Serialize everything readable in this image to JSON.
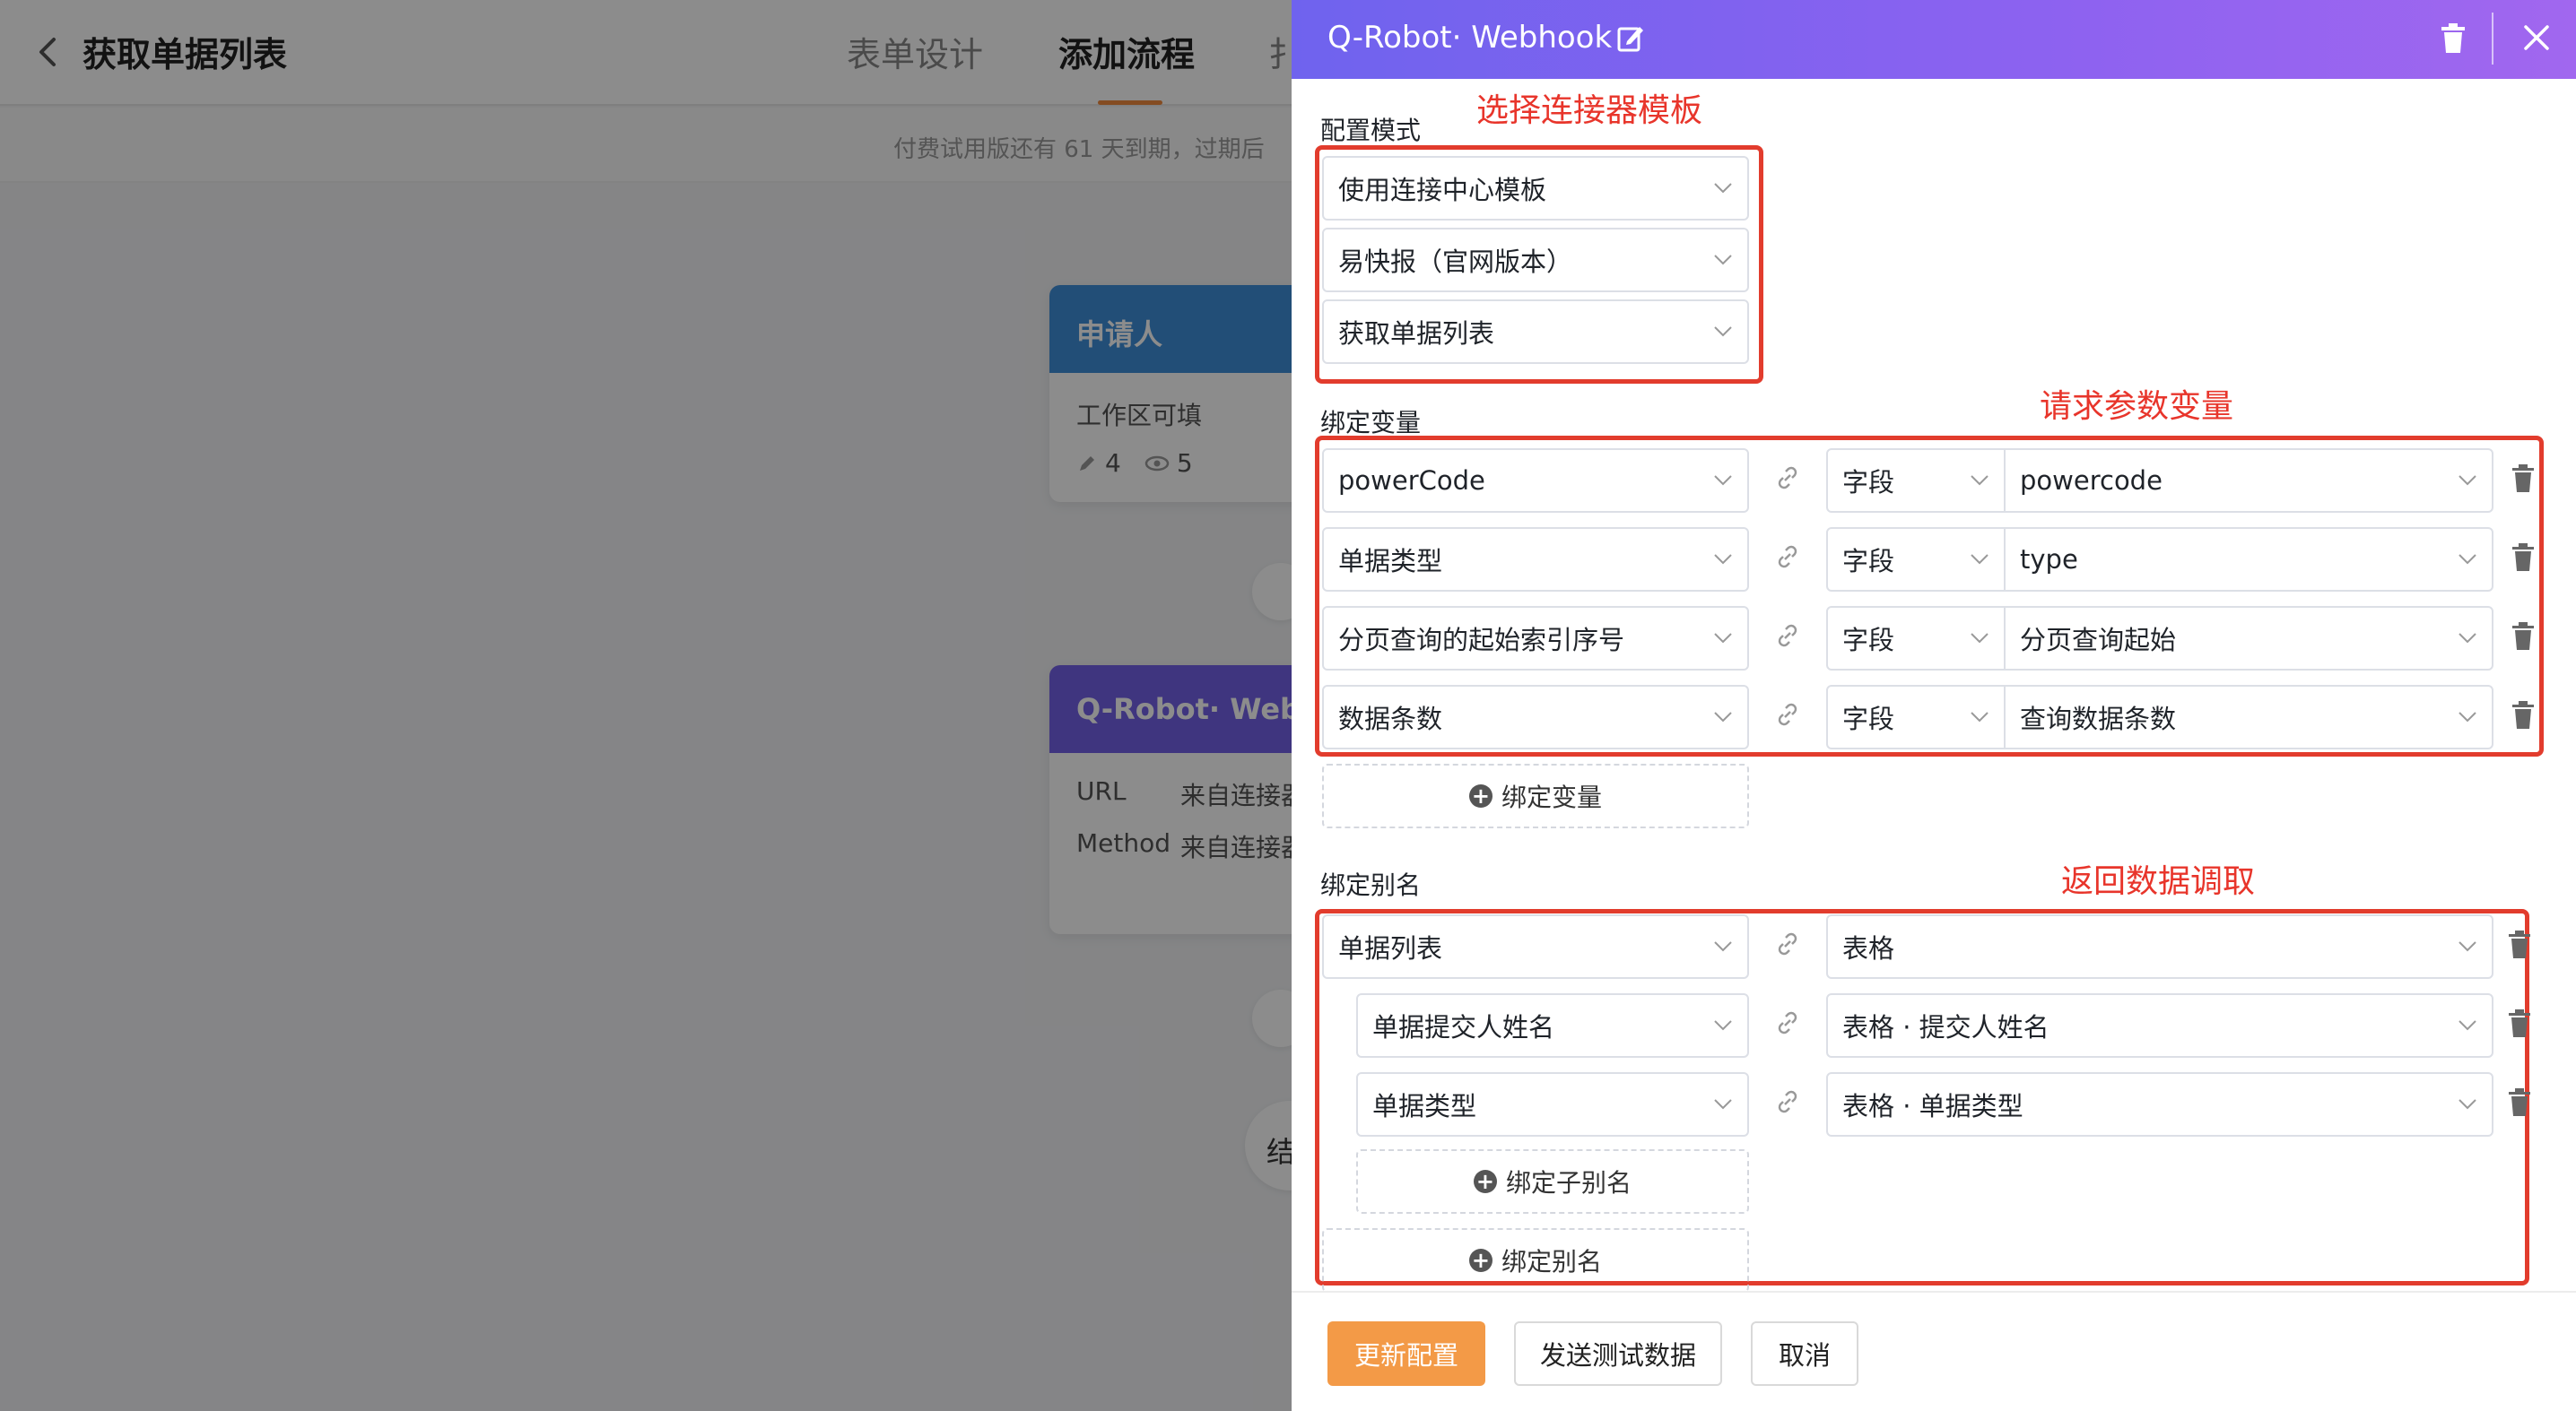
{
  "app": {
    "page_title": "获取单据列表",
    "tabs": [
      "表单设计",
      "添加流程",
      "扌"
    ],
    "notice": "付费试用版还有 61 天到期，过期后"
  },
  "flow": {
    "applicant_card": {
      "title": "申请人",
      "subtitle": "工作区可填",
      "edit_count": "4",
      "view_count": "5"
    },
    "robot_card": {
      "title": "Q-Robot· Webh",
      "rows": [
        {
          "key": "URL",
          "value": "来自连接器"
        },
        {
          "key": "Method",
          "value": "来自连接器"
        }
      ]
    },
    "end_label": "结"
  },
  "drawer": {
    "title": "Q-Robot· Webhook",
    "config_mode": {
      "label": "配置模式",
      "selects": [
        "使用连接中心模板",
        "易快报（官网版本）",
        "获取单据列表"
      ]
    },
    "bind_vars": {
      "label": "绑定变量",
      "rows": [
        {
          "param": "powerCode",
          "kind": "字段",
          "value": "powercode"
        },
        {
          "param": "单据类型",
          "kind": "字段",
          "value": "type"
        },
        {
          "param": "分页查询的起始索引序号",
          "kind": "字段",
          "value": "分页查询起始"
        },
        {
          "param": "数据条数",
          "kind": "字段",
          "value": "查询数据条数"
        }
      ],
      "add_button": "绑定变量"
    },
    "bind_alias": {
      "label": "绑定别名",
      "parent": {
        "name": "单据列表",
        "value": "表格"
      },
      "children": [
        {
          "name": "单据提交人姓名",
          "value": "表格 · 提交人姓名"
        },
        {
          "name": "单据类型",
          "value": "表格 · 单据类型"
        }
      ],
      "add_child_button": "绑定子别名",
      "add_button": "绑定别名"
    },
    "footer": {
      "update": "更新配置",
      "send_test": "发送测试数据",
      "cancel": "取消"
    }
  },
  "annotations": {
    "select_template": "选择连接器模板",
    "request_params": "请求参数变量",
    "return_data": "返回数据调取"
  },
  "colors": {
    "header_gradient_start": "#6f63ee",
    "header_gradient_end": "#a167ef",
    "primary_button": "#f39a47",
    "annotation_red": "#e23c2d",
    "applicant_card": "#3e8fd9",
    "robot_card": "#7362e8"
  }
}
